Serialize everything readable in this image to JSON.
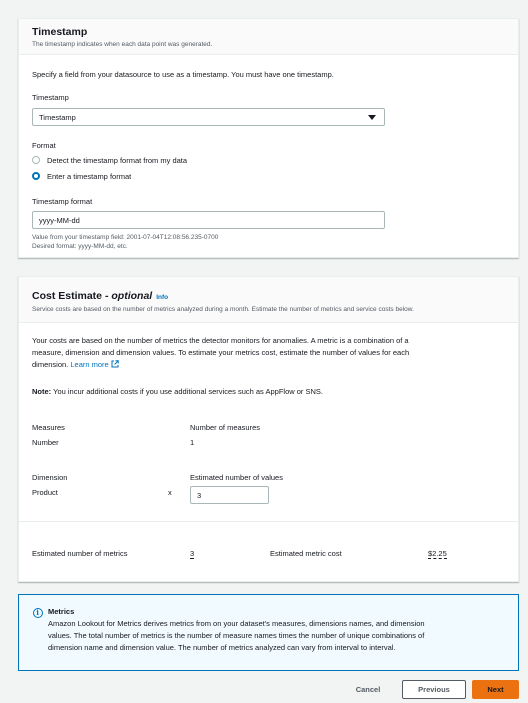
{
  "timestamp_panel": {
    "title": "Timestamp",
    "description": "The timestamp indicates when each data point was generated.",
    "intro": "Specify a field from your datasource to use as a timestamp. You must have one timestamp.",
    "field_label": "Timestamp",
    "field_value": "Timestamp",
    "format_label": "Format",
    "radio_detect": "Detect the timestamp format from my data",
    "radio_enter": "Enter a timestamp format",
    "selected_radio": "Enter a timestamp format",
    "ts_format_label": "Timestamp format",
    "ts_format_value": "yyyy-MM-dd",
    "hint_line1": "Value from your timestamp field: 2001-07-04T12:08:56.235-0700",
    "hint_line2": "Desired format: yyyy-MM-dd, etc."
  },
  "cost_panel": {
    "title": "Cost Estimate",
    "title_sep": " - ",
    "title_optional": "optional",
    "info_link": "Info",
    "description": "Service costs are based on the number of metrics analyzed during a month. Estimate the number of metrics and service costs below.",
    "body_line1": "Your costs are based on the number of metrics the detector monitors for anomalies. A metric is a combination of a",
    "body_line2": "measure, dimension and dimension values. To estimate your metrics cost, estimate the number of values for each",
    "body_line3": "dimension.",
    "learn_more": "Learn more",
    "note_label": "Note:",
    "note_text": "You incur additional costs if you use additional services such as AppFlow or SNS.",
    "measures_label": "Measures",
    "measures_value": "Number",
    "num_measures_label": "Number of measures",
    "num_measures_value": "1",
    "dimension_label": "Dimension",
    "dimension_value": "Product",
    "multiply_sign": "x",
    "est_values_label": "Estimated number of values",
    "est_values_value": "3",
    "est_metrics_label": "Estimated number of metrics",
    "est_metrics_value": "3",
    "est_cost_label": "Estimated metric cost",
    "est_cost_value": "$2.25"
  },
  "alert": {
    "title": "Metrics",
    "line1": "Amazon Lookout for Metrics derives metrics from on your dataset's measures, dimensions names, and dimension",
    "line2": "values. The total number of metrics is the number of measure names times the number of unique combinations of",
    "line3": "dimension name and dimension value. The number of metrics analyzed can vary from interval to interval."
  },
  "footer": {
    "cancel": "Cancel",
    "previous": "Previous",
    "next": "Next"
  },
  "colors": {
    "accent": "#0073bb",
    "primary_button": "#ec7211",
    "alert_background": "#f1faff"
  }
}
